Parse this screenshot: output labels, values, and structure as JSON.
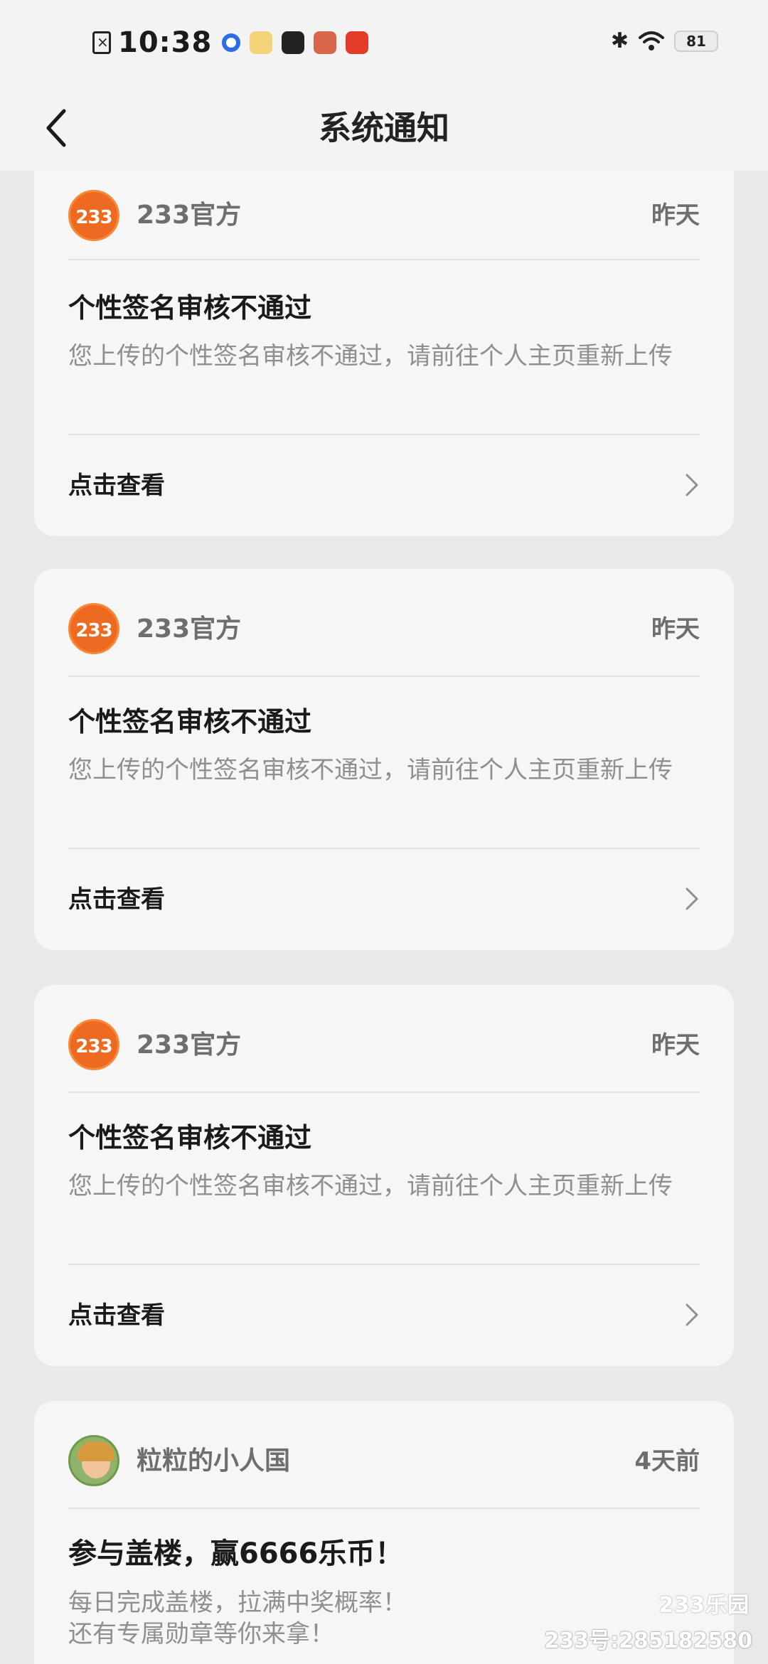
{
  "status_bar": {
    "time": "10:38",
    "battery": "81"
  },
  "header": {
    "title": "系统通知"
  },
  "notifications": [
    {
      "sender": "233官方",
      "avatar_text": "233",
      "time": "昨天",
      "title": "个性签名审核不通过",
      "body": "您上传的个性签名审核不通过，请前往个人主页重新上传",
      "action": "点击查看"
    },
    {
      "sender": "233官方",
      "avatar_text": "233",
      "time": "昨天",
      "title": "个性签名审核不通过",
      "body": "您上传的个性签名审核不通过，请前往个人主页重新上传",
      "action": "点击查看"
    },
    {
      "sender": "233官方",
      "avatar_text": "233",
      "time": "昨天",
      "title": "个性签名审核不通过",
      "body": "您上传的个性签名审核不通过，请前往个人主页重新上传",
      "action": "点击查看"
    },
    {
      "sender": "粒粒的小人国",
      "time": "4天前",
      "title": "参与盖楼，赢6666乐币！",
      "body_line1": "每日完成盖楼，拉满中奖概率！",
      "body_line2": "还有专属勋章等你来拿！"
    }
  ],
  "watermark": {
    "logo": "233乐园",
    "id": "233号:285182580"
  },
  "colors": {
    "background": "#e9e8ea",
    "card": "#f6f6f7",
    "brand_orange": "#ef6a21",
    "secondary_text": "#8e8e93"
  }
}
